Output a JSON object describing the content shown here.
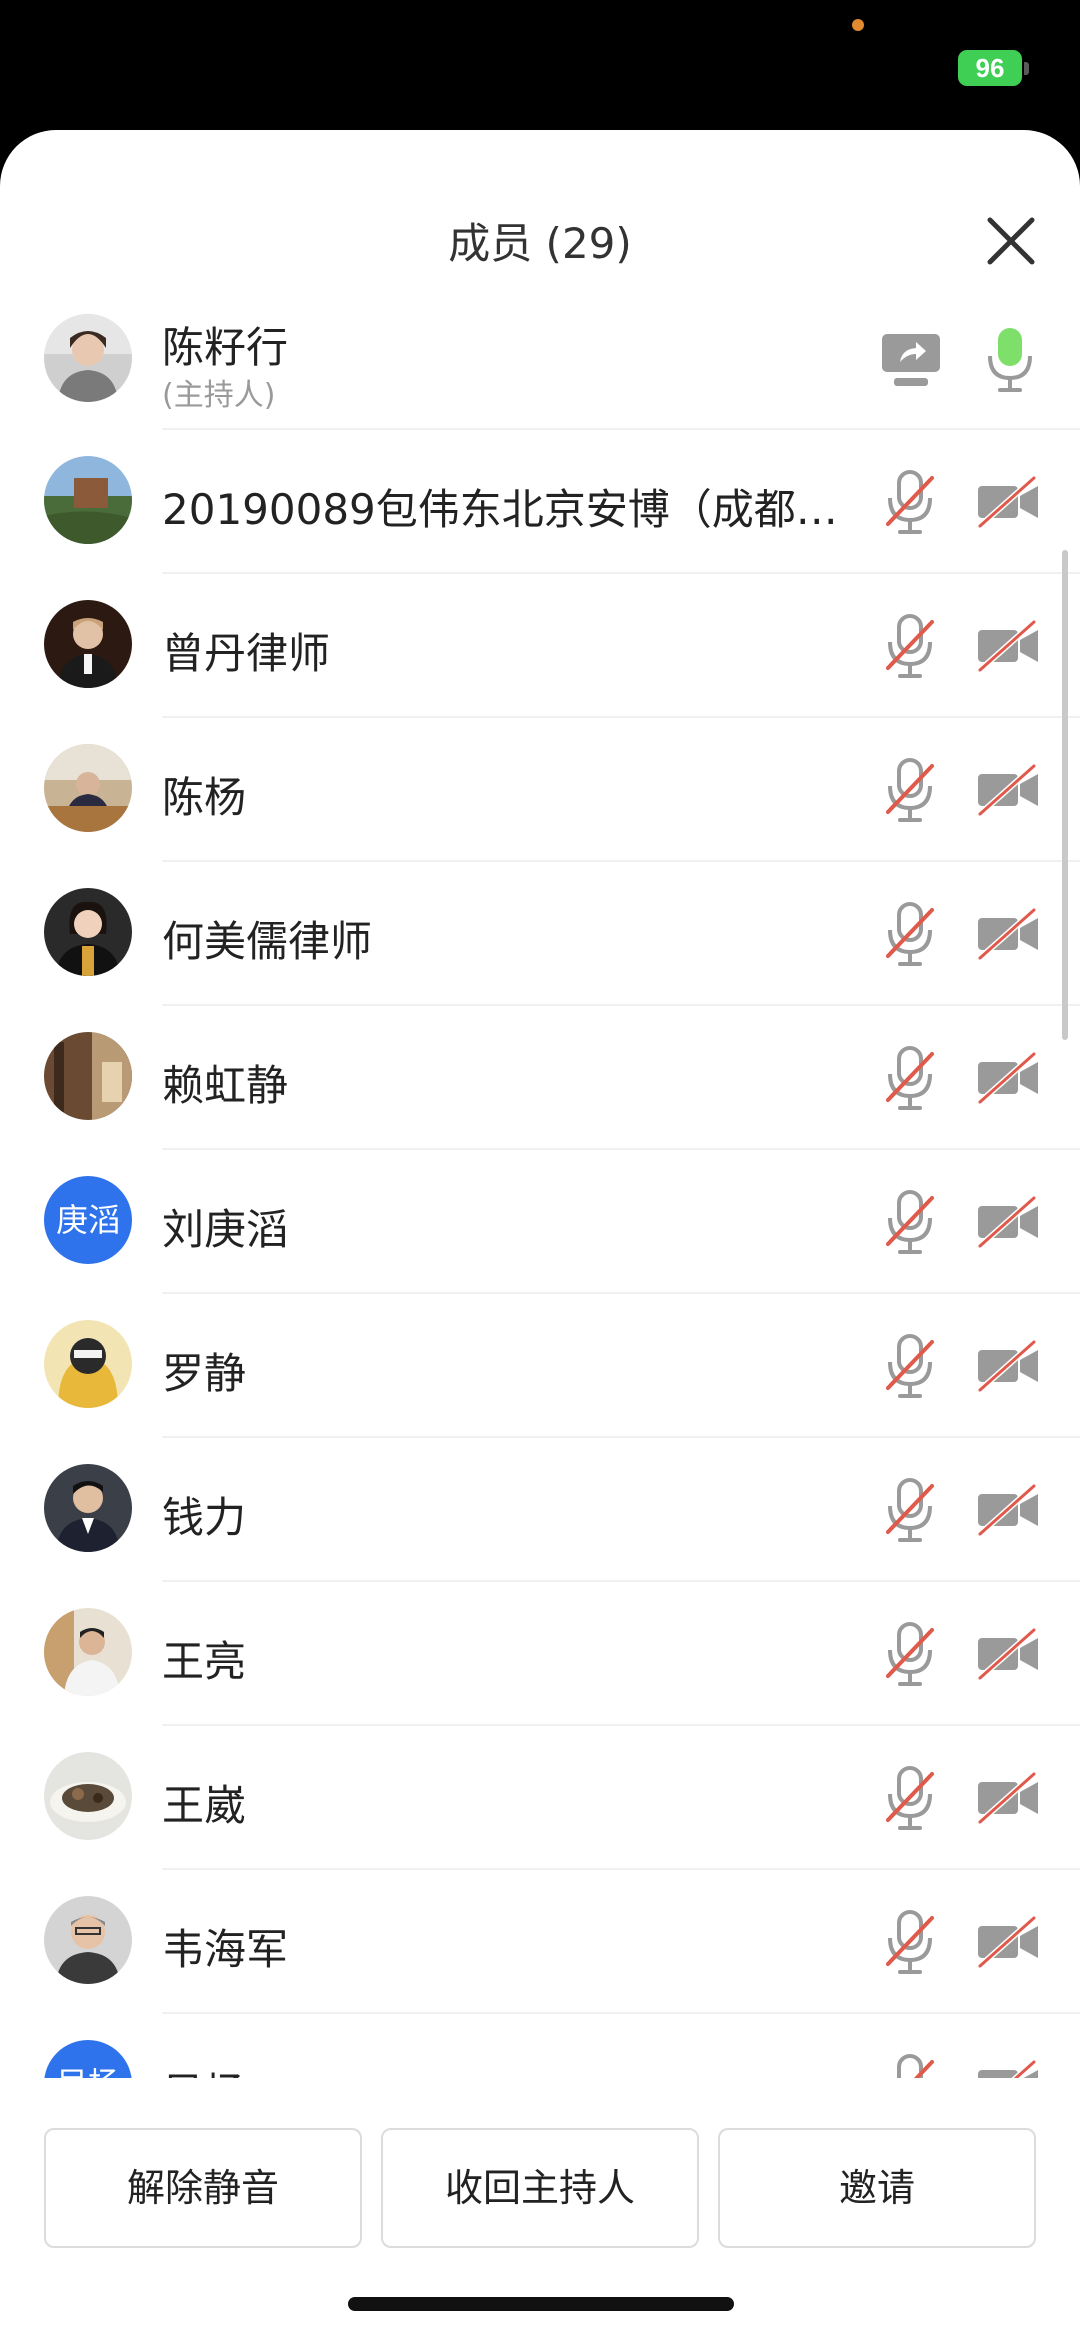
{
  "status_bar": {
    "battery_text": "96"
  },
  "header": {
    "title": "成员 (29)"
  },
  "host": {
    "name": "陈籽行",
    "role": "(主持人)"
  },
  "members": [
    {
      "name": "20190089包伟东北京安博（成都…"
    },
    {
      "name": "曾丹律师"
    },
    {
      "name": "陈杨"
    },
    {
      "name": "何美儒律师"
    },
    {
      "name": "赖虹静"
    },
    {
      "name": "刘庚滔",
      "avatar_text": "庚滔"
    },
    {
      "name": "罗静"
    },
    {
      "name": "钱力"
    },
    {
      "name": "王亮"
    },
    {
      "name": "王崴"
    },
    {
      "name": "韦海军"
    },
    {
      "name": "吴杨",
      "avatar_text": "吴杨"
    }
  ],
  "actions": {
    "unmute": "解除静音",
    "revoke_host": "收回主持人",
    "invite": "邀请"
  },
  "colors": {
    "accent_blue": "#2e73ec",
    "mic_green": "#7ee06a",
    "muted_red": "#e05a4b",
    "icon_gray": "#9a9a9a",
    "battery_green": "#3ecf54"
  }
}
